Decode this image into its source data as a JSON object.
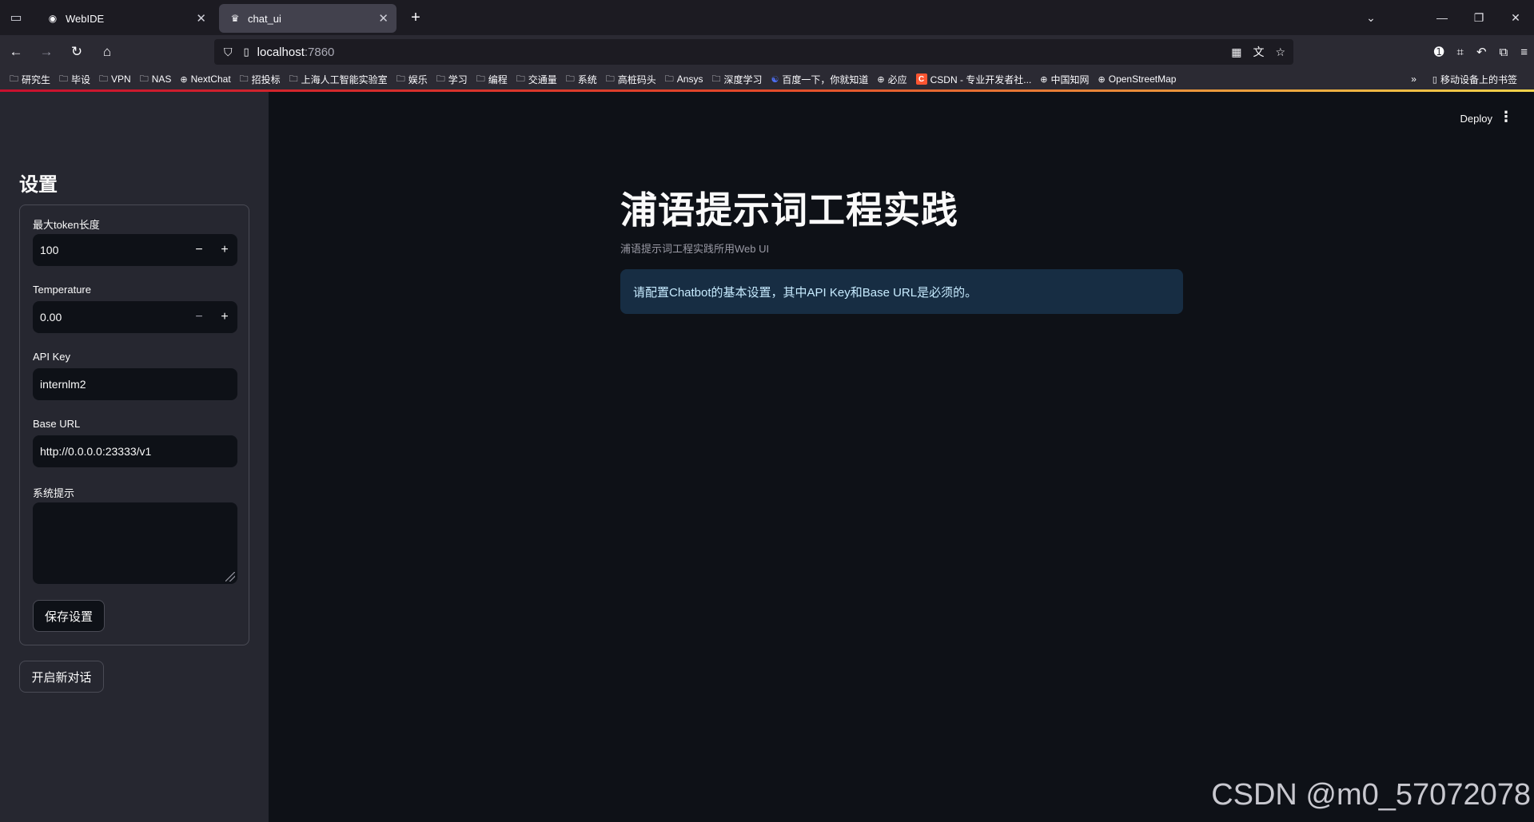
{
  "browser": {
    "tabs": [
      {
        "label": "WebIDE",
        "active": false,
        "icon": "webide-favicon"
      },
      {
        "label": "chat_ui",
        "active": true,
        "icon": "streamlit-favicon"
      }
    ],
    "url": {
      "host": "localhost",
      "port": ":7860"
    },
    "bookmarks": [
      {
        "label": "研究生",
        "icon": "folder-icon"
      },
      {
        "label": "毕设",
        "icon": "folder-icon"
      },
      {
        "label": "VPN",
        "icon": "folder-icon"
      },
      {
        "label": "NAS",
        "icon": "folder-icon"
      },
      {
        "label": "NextChat",
        "icon": "globe-icon"
      },
      {
        "label": "招投标",
        "icon": "folder-icon"
      },
      {
        "label": "上海人工智能实验室",
        "icon": "folder-icon"
      },
      {
        "label": "娱乐",
        "icon": "folder-icon"
      },
      {
        "label": "学习",
        "icon": "folder-icon"
      },
      {
        "label": "编程",
        "icon": "folder-icon"
      },
      {
        "label": "交通量",
        "icon": "folder-icon"
      },
      {
        "label": "系统",
        "icon": "folder-icon"
      },
      {
        "label": "高桩码头",
        "icon": "folder-icon"
      },
      {
        "label": "Ansys",
        "icon": "folder-icon"
      },
      {
        "label": "深度学习",
        "icon": "folder-icon"
      },
      {
        "label": "百度一下，你就知道",
        "icon": "baidu-icon"
      },
      {
        "label": "必应",
        "icon": "globe-icon"
      },
      {
        "label": "CSDN - 专业开发者社...",
        "icon": "csdn-icon"
      },
      {
        "label": "中国知网",
        "icon": "globe-icon"
      },
      {
        "label": "OpenStreetMap",
        "icon": "globe-icon"
      }
    ],
    "mobile_bookmarks": "移动设备上的书签"
  },
  "sidebar": {
    "title": "设置",
    "max_tokens": {
      "label": "最大token长度",
      "value": "100"
    },
    "temperature": {
      "label": "Temperature",
      "value": "0.00"
    },
    "api_key": {
      "label": "API Key",
      "value": "internlm2"
    },
    "base_url": {
      "label": "Base URL",
      "value": "http://0.0.0.0:23333/v1"
    },
    "system_prompt": {
      "label": "系统提示",
      "value": ""
    },
    "save_label": "保存设置",
    "new_chat_label": "开启新对话"
  },
  "header": {
    "deploy_label": "Deploy"
  },
  "main": {
    "title": "浦语提示词工程实践",
    "caption": "浦语提示词工程实践所用Web UI",
    "info": "请配置Chatbot的基本设置，其中API Key和Base URL是必须的。"
  },
  "watermark": "CSDN @m0_57072078",
  "colors": {
    "background": "#0e1117",
    "sidebar": "#262730",
    "info_bg": "#172d43",
    "info_text": "#c7ebff"
  }
}
